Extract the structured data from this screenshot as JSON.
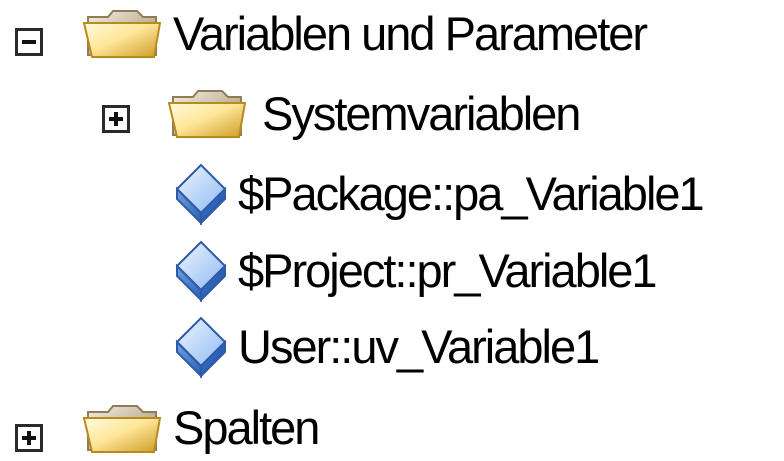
{
  "tree": {
    "nodes": [
      {
        "label": "Variablen und Parameter",
        "icon": "folder-icon",
        "toggle": "collapse"
      },
      {
        "label": "Systemvariablen",
        "icon": "folder-icon",
        "toggle": "expand"
      },
      {
        "label": "$Package::pa_Variable1",
        "icon": "variable-icon"
      },
      {
        "label": "$Project::pr_Variable1",
        "icon": "variable-icon"
      },
      {
        "label": "User::uv_Variable1",
        "icon": "variable-icon"
      },
      {
        "label": "Spalten",
        "icon": "folder-icon",
        "toggle": "expand"
      }
    ]
  },
  "colors": {
    "folder_light": "#fff6b8",
    "folder_dark": "#d7a22a",
    "variable_light": "#b9d7ff",
    "variable_dark": "#3a78c8"
  }
}
